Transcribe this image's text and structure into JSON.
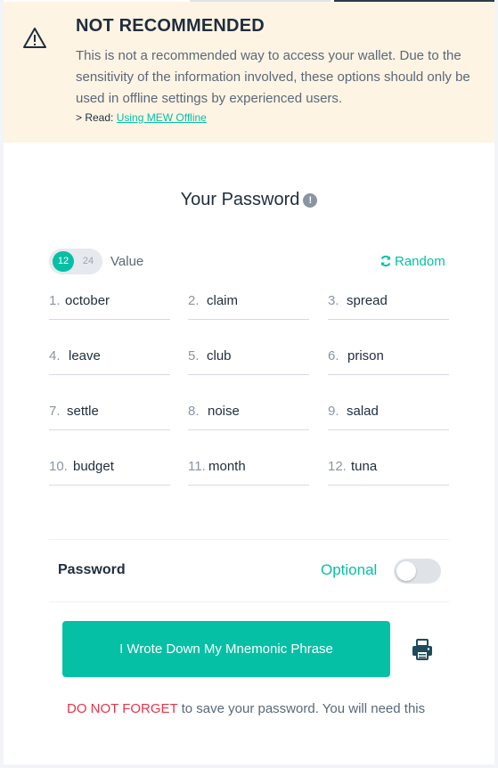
{
  "warning": {
    "title": "NOT RECOMMENDED",
    "body": "This is not a recommended way to access your wallet. Due to the sensitivity of the information involved, these options should only be used in offline settings by experienced users.",
    "read_prefix": "> Read: ",
    "read_link": "Using MEW Offline",
    "icon": "warning-triangle-icon"
  },
  "mnemonic": {
    "title": "Your Password",
    "info_icon": "info-icon",
    "toggle": {
      "option_12": "12",
      "option_24": "24",
      "selected": "12"
    },
    "value_label": "Value",
    "random_label": "Random",
    "words": [
      {
        "num": "1.",
        "word": "october"
      },
      {
        "num": "2.",
        "word": "claim"
      },
      {
        "num": "3.",
        "word": "spread"
      },
      {
        "num": "4.",
        "word": "leave"
      },
      {
        "num": "5.",
        "word": "club"
      },
      {
        "num": "6.",
        "word": "prison"
      },
      {
        "num": "7.",
        "word": "settle"
      },
      {
        "num": "8.",
        "word": "noise"
      },
      {
        "num": "9.",
        "word": "salad"
      },
      {
        "num": "10.",
        "word": "budget"
      },
      {
        "num": "11.",
        "word": "month"
      },
      {
        "num": "12.",
        "word": "tuna"
      }
    ]
  },
  "password": {
    "label": "Password",
    "optional": "Optional",
    "enabled": false
  },
  "actions": {
    "wrote_down": "I Wrote Down My Mnemonic Phrase",
    "print_icon": "printer-icon"
  },
  "footer": {
    "highlight": "DO NOT FORGET",
    "rest": " to save your password. You will need this"
  },
  "colors": {
    "accent": "#05c0a5",
    "warning_bg": "#fef4e4",
    "danger": "#e5344a"
  }
}
